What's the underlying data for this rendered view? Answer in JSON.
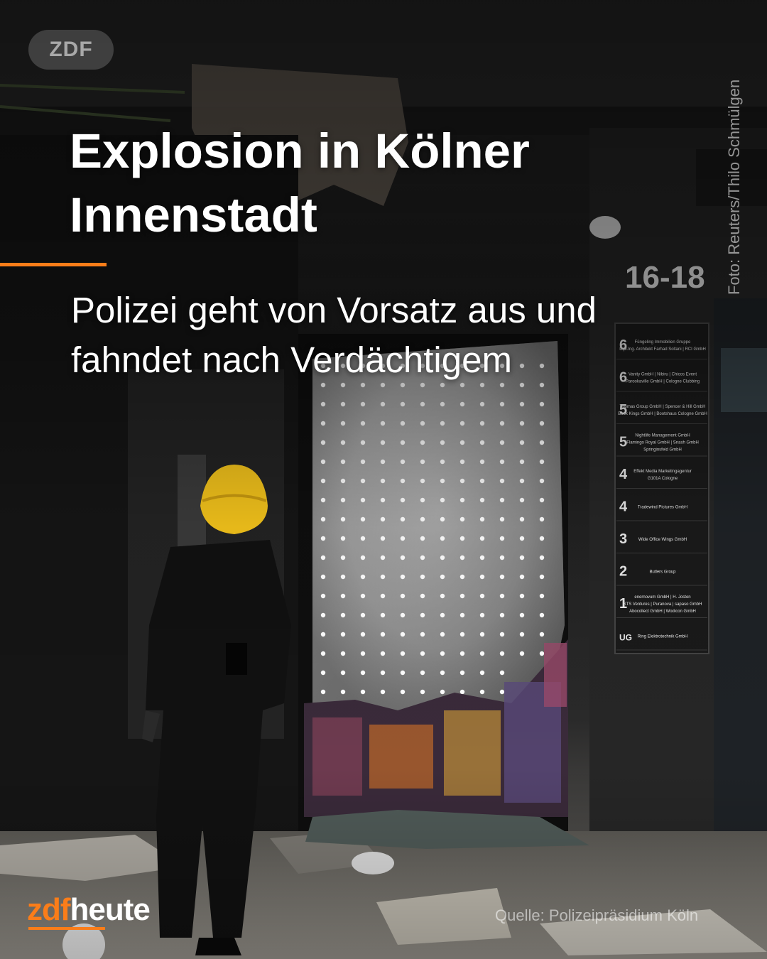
{
  "logo": {
    "text": "ZDF"
  },
  "photo_credit": "Foto: Reuters/Thilo Schmülgen",
  "headline": "Explosion in Kölner Innenstadt",
  "subline": "Polizei geht von Vorsatz aus und fahndet nach Verdächtigem",
  "brand": {
    "zdf": "zdf",
    "heute": "heute"
  },
  "source": "Quelle: Polizeipräsidium Köln",
  "house_number": "16-18",
  "directory": [
    {
      "floor": "6",
      "tenants": [
        "Füngeling Immobilien Gruppe",
        "Dipl.Ing. Architekt Farhad Soltani | RCI GmbH"
      ]
    },
    {
      "floor": "6",
      "tenants": [
        "Vanity GmbH | Nibiru | Chicos Event",
        "Parookaville GmbH | Cologne Clubbing"
      ]
    },
    {
      "floor": "5",
      "tenants": [
        "Thomas Group GmbH | Spencer & Hill GmbH",
        "Book Kings GmbH | Bootshaus Cologne GmbH"
      ]
    },
    {
      "floor": "5",
      "tenants": [
        "Nightlife Management GmbH",
        "Flamingo Royal GmbH | Snash GmbH",
        "Springinsfeld GmbH"
      ]
    },
    {
      "floor": "4",
      "tenants": [
        "Effekt Media Marketingagentur",
        "G101A Cologne"
      ]
    },
    {
      "floor": "4",
      "tenants": [
        "Tradewind Pictures GmbH"
      ]
    },
    {
      "floor": "3",
      "tenants": [
        "Wide Office Wings GmbH"
      ]
    },
    {
      "floor": "2",
      "tenants": [
        "Butlers Group"
      ]
    },
    {
      "floor": "1",
      "tenants": [
        "enernovum GmbH | H. Josten",
        "STS Ventures | Puranova | sapaso GmbH",
        "Abocollect GmbH | Wodicon GmbH"
      ]
    },
    {
      "floor": "UG",
      "tenants": [
        "Ring Elektrotechnik GmbH"
      ]
    }
  ],
  "colors": {
    "accent": "#fa7d19",
    "helmet": "#f2c21b",
    "text": "#ffffff"
  }
}
